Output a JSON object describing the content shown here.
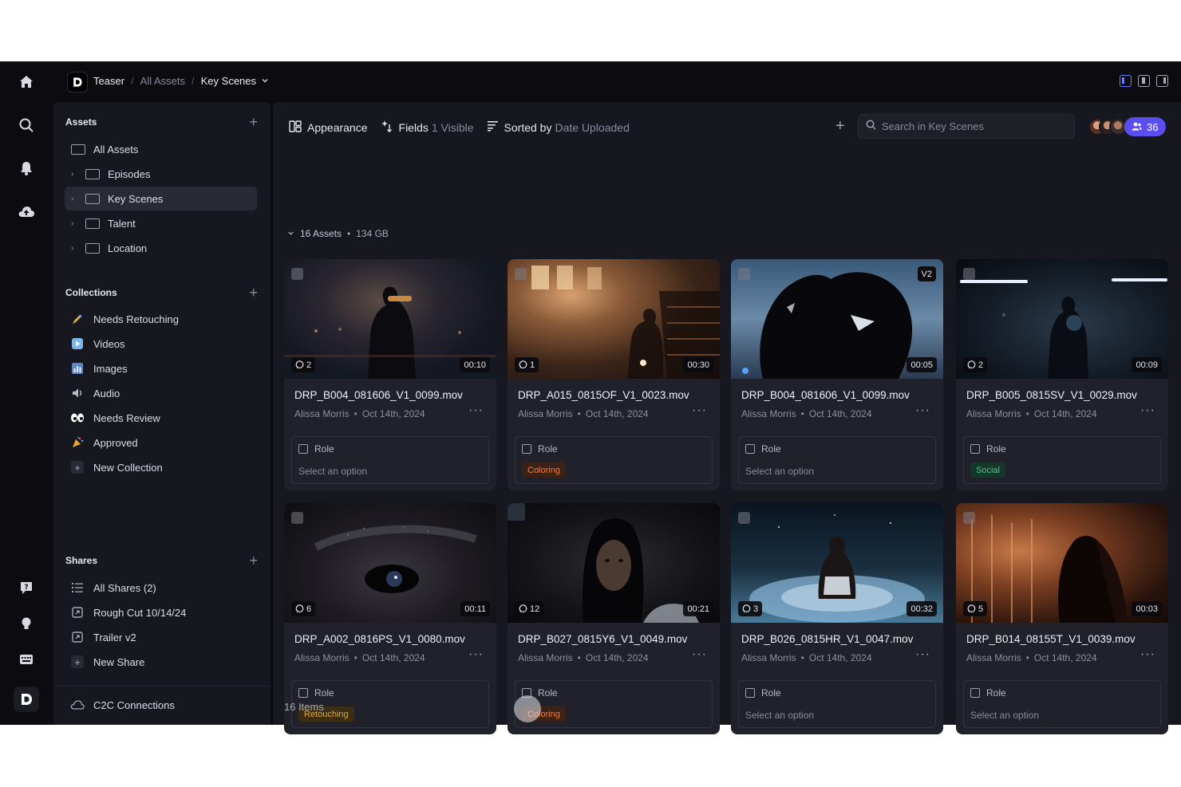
{
  "breadcrumb": {
    "project": "Teaser",
    "parent": "All Assets",
    "current": "Key Scenes"
  },
  "sidebar": {
    "assets_heading": "Assets",
    "assets": [
      {
        "label": "All Assets"
      },
      {
        "label": "Episodes"
      },
      {
        "label": "Key Scenes",
        "selected": true
      },
      {
        "label": "Talent"
      },
      {
        "label": "Location"
      }
    ],
    "collections_heading": "Collections",
    "collections": [
      {
        "label": "Needs Retouching",
        "icon": "pencil-icon"
      },
      {
        "label": "Videos",
        "icon": "play-icon"
      },
      {
        "label": "Images",
        "icon": "image-icon"
      },
      {
        "label": "Audio",
        "icon": "speaker-icon"
      },
      {
        "label": "Needs Review",
        "icon": "eyes-icon"
      },
      {
        "label": "Approved",
        "icon": "party-popper-icon"
      },
      {
        "label": "New Collection",
        "icon": "plus-icon"
      }
    ],
    "shares_heading": "Shares",
    "shares": [
      {
        "label": "All Shares (2)",
        "icon": "list-icon"
      },
      {
        "label": "Rough Cut 10/14/24",
        "icon": "share-icon"
      },
      {
        "label": "Trailer v2",
        "icon": "share-icon"
      },
      {
        "label": "New Share",
        "icon": "plus-icon"
      }
    ],
    "c2c": "C2C Connections"
  },
  "toolbar": {
    "appearance": "Appearance",
    "fields": "Fields",
    "fields_count": "1 Visible",
    "sorted_by": "Sorted by",
    "sort_value": "Date Uploaded",
    "search_placeholder": "Search in Key Scenes",
    "share_count": "36"
  },
  "summary": {
    "assets": "16 Assets",
    "size": "134 GB"
  },
  "assets": [
    {
      "name": "DRP_B004_081606_V1_0099.mov",
      "author": "Alissa Morris",
      "date": "Oct 14th, 2024",
      "duration": "00:10",
      "comments": "2",
      "version": "",
      "role_label": "Role",
      "role_value": "Select an option",
      "tag": ""
    },
    {
      "name": "DRP_A015_0815OF_V1_0023.mov",
      "author": "Alissa Morris",
      "date": "Oct 14th, 2024",
      "duration": "00:30",
      "comments": "1",
      "version": "",
      "role_label": "Role",
      "role_value": "",
      "tag": "Coloring"
    },
    {
      "name": "DRP_B004_081606_V1_0099.mov",
      "author": "Alissa Morris",
      "date": "Oct 14th, 2024",
      "duration": "00:05",
      "comments": "",
      "version": "V2",
      "role_label": "Role",
      "role_value": "Select an option",
      "tag": ""
    },
    {
      "name": "DRP_B005_0815SV_V1_0029.mov",
      "author": "Alissa Morris",
      "date": "Oct 14th, 2024",
      "duration": "00:09",
      "comments": "2",
      "version": "",
      "role_label": "Role",
      "role_value": "",
      "tag": "Social"
    },
    {
      "name": "DRP_A002_0816PS_V1_0080.mov",
      "author": "Alissa Morris",
      "date": "Oct 14th, 2024",
      "duration": "00:11",
      "comments": "6",
      "version": "",
      "role_label": "Role",
      "role_value": "",
      "tag": "Retouching"
    },
    {
      "name": "DRP_B027_0815Y6_V1_0049.mov",
      "author": "Alissa Morris",
      "date": "Oct 14th, 2024",
      "duration": "00:21",
      "comments": "12",
      "version": "",
      "role_label": "Role",
      "role_value": "",
      "tag": "Coloring"
    },
    {
      "name": "DRP_B026_0815HR_V1_0047.mov",
      "author": "Alissa Morris",
      "date": "Oct 14th, 2024",
      "duration": "00:32",
      "comments": "3",
      "version": "",
      "role_label": "Role",
      "role_value": "Select an option",
      "tag": ""
    },
    {
      "name": "DRP_B014_08155T_V1_0039.mov",
      "author": "Alissa Morris",
      "date": "Oct 14th, 2024",
      "duration": "00:03",
      "comments": "5",
      "version": "",
      "role_label": "Role",
      "role_value": "Select an option",
      "tag": ""
    }
  ],
  "footer": {
    "items": "16 Items"
  },
  "colors": {
    "accent": "#5b4ef0",
    "coloring": "#ef7d49",
    "social": "#46c98a",
    "retouching": "#e6a534",
    "background": "#0b0b10",
    "panel": "#17171f",
    "card": "#21212b"
  }
}
